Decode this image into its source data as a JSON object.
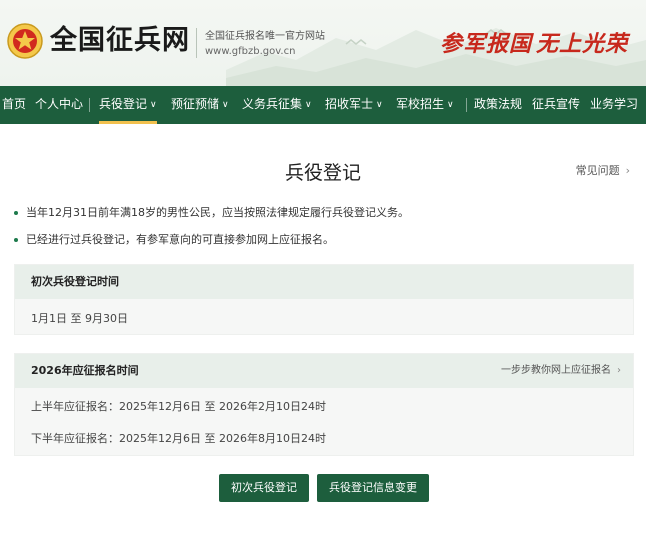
{
  "header": {
    "site_name": "全国征兵网",
    "tagline": "全国征兵报名唯一官方网站",
    "domain": "www.gfbzb.gov.cn",
    "slogan_1": "参军报国",
    "slogan_2": "无上光荣",
    "brand_color": "#1d5e3d",
    "slogan_color": "#c7281c"
  },
  "nav": {
    "items": [
      {
        "label": "首页"
      },
      {
        "label": "个人中心"
      },
      {
        "label": "兵役登记"
      },
      {
        "label": "预征预储"
      },
      {
        "label": "义务兵征集"
      },
      {
        "label": "招收军士"
      },
      {
        "label": "军校招生"
      },
      {
        "label": "政策法规"
      },
      {
        "label": "征兵宣传"
      },
      {
        "label": "业务学习"
      }
    ],
    "active": "兵役登记"
  },
  "main": {
    "title": "兵役登记",
    "faq_label": "常见问题",
    "bullets": [
      "当年12月31日前年满18岁的男性公民，应当按照法律规定履行兵役登记义务。",
      "已经进行过兵役登记，有参军意向的可直接参加网上应征报名。"
    ],
    "card_initial": {
      "title": "初次兵役登记时间",
      "rows": [
        "1月1日 至 9月30日"
      ]
    },
    "card_enlist": {
      "title": "2026年应征报名时间",
      "link": "一步步教你网上应征报名",
      "rows": [
        "上半年应征报名：2025年12月6日 至 2026年2月10日24时",
        "下半年应征报名：2025年12月6日 至 2026年8月10日24时"
      ]
    },
    "buttons": {
      "initial_register": "初次兵役登记",
      "info_change": "兵役登记信息变更"
    }
  }
}
